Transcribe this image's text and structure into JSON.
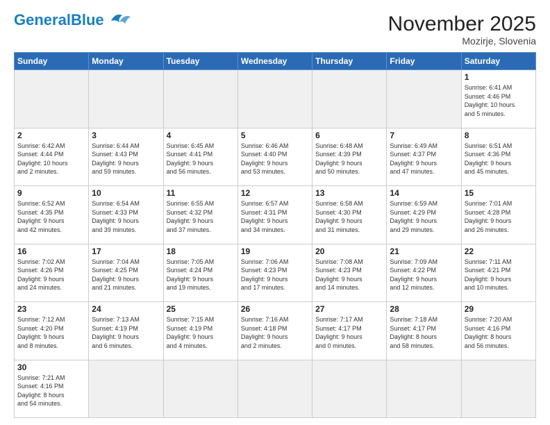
{
  "header": {
    "logo_general": "General",
    "logo_blue": "Blue",
    "month_year": "November 2025",
    "location": "Mozirje, Slovenia"
  },
  "weekdays": [
    "Sunday",
    "Monday",
    "Tuesday",
    "Wednesday",
    "Thursday",
    "Friday",
    "Saturday"
  ],
  "weeks": [
    [
      {
        "num": "",
        "info": ""
      },
      {
        "num": "",
        "info": ""
      },
      {
        "num": "",
        "info": ""
      },
      {
        "num": "",
        "info": ""
      },
      {
        "num": "",
        "info": ""
      },
      {
        "num": "",
        "info": ""
      },
      {
        "num": "1",
        "info": "Sunrise: 6:41 AM\nSunset: 4:46 PM\nDaylight: 10 hours\nand 5 minutes."
      }
    ],
    [
      {
        "num": "2",
        "info": "Sunrise: 6:42 AM\nSunset: 4:44 PM\nDaylight: 10 hours\nand 2 minutes."
      },
      {
        "num": "3",
        "info": "Sunrise: 6:44 AM\nSunset: 4:43 PM\nDaylight: 9 hours\nand 59 minutes."
      },
      {
        "num": "4",
        "info": "Sunrise: 6:45 AM\nSunset: 4:41 PM\nDaylight: 9 hours\nand 56 minutes."
      },
      {
        "num": "5",
        "info": "Sunrise: 6:46 AM\nSunset: 4:40 PM\nDaylight: 9 hours\nand 53 minutes."
      },
      {
        "num": "6",
        "info": "Sunrise: 6:48 AM\nSunset: 4:39 PM\nDaylight: 9 hours\nand 50 minutes."
      },
      {
        "num": "7",
        "info": "Sunrise: 6:49 AM\nSunset: 4:37 PM\nDaylight: 9 hours\nand 47 minutes."
      },
      {
        "num": "8",
        "info": "Sunrise: 6:51 AM\nSunset: 4:36 PM\nDaylight: 9 hours\nand 45 minutes."
      }
    ],
    [
      {
        "num": "9",
        "info": "Sunrise: 6:52 AM\nSunset: 4:35 PM\nDaylight: 9 hours\nand 42 minutes."
      },
      {
        "num": "10",
        "info": "Sunrise: 6:54 AM\nSunset: 4:33 PM\nDaylight: 9 hours\nand 39 minutes."
      },
      {
        "num": "11",
        "info": "Sunrise: 6:55 AM\nSunset: 4:32 PM\nDaylight: 9 hours\nand 37 minutes."
      },
      {
        "num": "12",
        "info": "Sunrise: 6:57 AM\nSunset: 4:31 PM\nDaylight: 9 hours\nand 34 minutes."
      },
      {
        "num": "13",
        "info": "Sunrise: 6:58 AM\nSunset: 4:30 PM\nDaylight: 9 hours\nand 31 minutes."
      },
      {
        "num": "14",
        "info": "Sunrise: 6:59 AM\nSunset: 4:29 PM\nDaylight: 9 hours\nand 29 minutes."
      },
      {
        "num": "15",
        "info": "Sunrise: 7:01 AM\nSunset: 4:28 PM\nDaylight: 9 hours\nand 26 minutes."
      }
    ],
    [
      {
        "num": "16",
        "info": "Sunrise: 7:02 AM\nSunset: 4:26 PM\nDaylight: 9 hours\nand 24 minutes."
      },
      {
        "num": "17",
        "info": "Sunrise: 7:04 AM\nSunset: 4:25 PM\nDaylight: 9 hours\nand 21 minutes."
      },
      {
        "num": "18",
        "info": "Sunrise: 7:05 AM\nSunset: 4:24 PM\nDaylight: 9 hours\nand 19 minutes."
      },
      {
        "num": "19",
        "info": "Sunrise: 7:06 AM\nSunset: 4:23 PM\nDaylight: 9 hours\nand 17 minutes."
      },
      {
        "num": "20",
        "info": "Sunrise: 7:08 AM\nSunset: 4:23 PM\nDaylight: 9 hours\nand 14 minutes."
      },
      {
        "num": "21",
        "info": "Sunrise: 7:09 AM\nSunset: 4:22 PM\nDaylight: 9 hours\nand 12 minutes."
      },
      {
        "num": "22",
        "info": "Sunrise: 7:11 AM\nSunset: 4:21 PM\nDaylight: 9 hours\nand 10 minutes."
      }
    ],
    [
      {
        "num": "23",
        "info": "Sunrise: 7:12 AM\nSunset: 4:20 PM\nDaylight: 9 hours\nand 8 minutes."
      },
      {
        "num": "24",
        "info": "Sunrise: 7:13 AM\nSunset: 4:19 PM\nDaylight: 9 hours\nand 6 minutes."
      },
      {
        "num": "25",
        "info": "Sunrise: 7:15 AM\nSunset: 4:19 PM\nDaylight: 9 hours\nand 4 minutes."
      },
      {
        "num": "26",
        "info": "Sunrise: 7:16 AM\nSunset: 4:18 PM\nDaylight: 9 hours\nand 2 minutes."
      },
      {
        "num": "27",
        "info": "Sunrise: 7:17 AM\nSunset: 4:17 PM\nDaylight: 9 hours\nand 0 minutes."
      },
      {
        "num": "28",
        "info": "Sunrise: 7:18 AM\nSunset: 4:17 PM\nDaylight: 8 hours\nand 58 minutes."
      },
      {
        "num": "29",
        "info": "Sunrise: 7:20 AM\nSunset: 4:16 PM\nDaylight: 8 hours\nand 56 minutes."
      }
    ],
    [
      {
        "num": "30",
        "info": "Sunrise: 7:21 AM\nSunset: 4:16 PM\nDaylight: 8 hours\nand 54 minutes."
      },
      {
        "num": "",
        "info": ""
      },
      {
        "num": "",
        "info": ""
      },
      {
        "num": "",
        "info": ""
      },
      {
        "num": "",
        "info": ""
      },
      {
        "num": "",
        "info": ""
      },
      {
        "num": "",
        "info": ""
      }
    ]
  ]
}
